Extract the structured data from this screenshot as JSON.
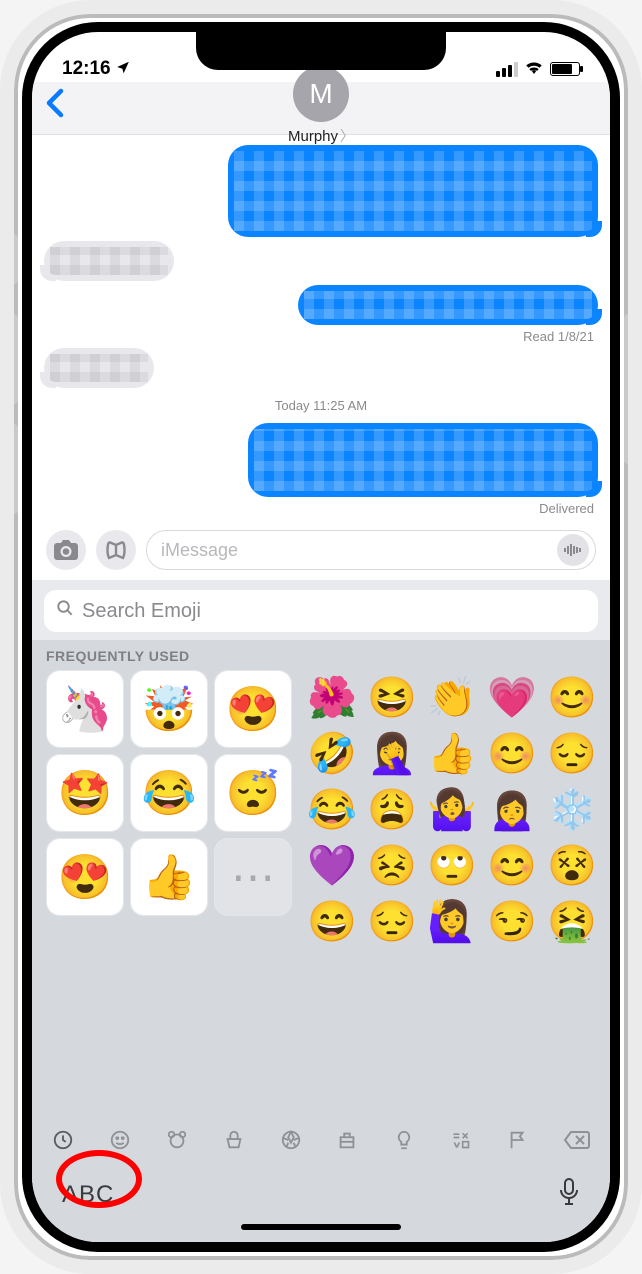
{
  "status": {
    "time": "12:16"
  },
  "header": {
    "avatar_initial": "M",
    "contact_name": "Murphy"
  },
  "thread": {
    "read_stamp": "Read 1/8/21",
    "timestamp": "Today 11:25 AM",
    "delivered_stamp": "Delivered"
  },
  "compose": {
    "placeholder": "iMessage"
  },
  "emoji": {
    "search_placeholder": "Search Emoji",
    "section_label": "FREQUENTLY USED",
    "memoji": [
      "🦄",
      "🤯",
      "😍",
      "🤩",
      "😂",
      "😴",
      "😍",
      "👍",
      "⋯"
    ],
    "emojis": [
      "🌺",
      "😆",
      "👏",
      "💗",
      "😊",
      "🤣",
      "🤦‍♀️",
      "👍",
      "😊",
      "😔",
      "😂",
      "😩",
      "🤷‍♀️",
      "🙍‍♀️",
      "❄️",
      "💜",
      "😣",
      "🙄",
      "😊",
      "😵",
      "😄",
      "😔",
      "🙋‍♀️",
      "😏",
      "🤮"
    ],
    "abc_label": "ABC"
  }
}
